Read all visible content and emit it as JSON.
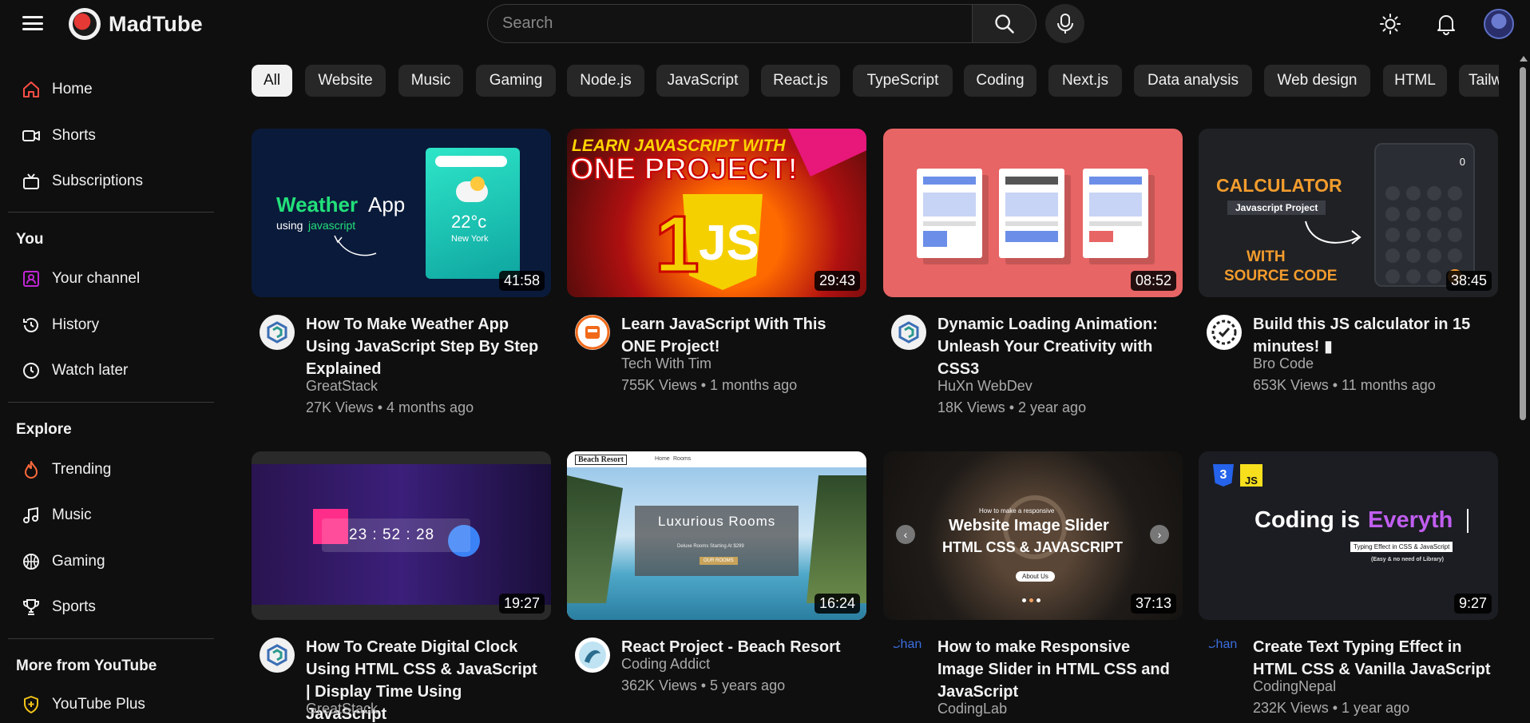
{
  "header": {
    "app_name": "MadTube",
    "search_placeholder": "Search"
  },
  "sidebar": {
    "main": [
      {
        "label": "Home",
        "icon": "home-icon"
      },
      {
        "label": "Shorts",
        "icon": "shorts-icon"
      },
      {
        "label": "Subscriptions",
        "icon": "subscriptions-icon"
      }
    ],
    "you_heading": "You",
    "you": [
      {
        "label": "Your channel",
        "icon": "your-channel-icon"
      },
      {
        "label": "History",
        "icon": "history-icon"
      },
      {
        "label": "Watch later",
        "icon": "watch-later-icon"
      }
    ],
    "explore_heading": "Explore",
    "explore": [
      {
        "label": "Trending",
        "icon": "trending-icon"
      },
      {
        "label": "Music",
        "icon": "music-icon"
      },
      {
        "label": "Gaming",
        "icon": "gaming-icon"
      },
      {
        "label": "Sports",
        "icon": "sports-icon"
      }
    ],
    "more_heading": "More from YouTube",
    "more": [
      {
        "label": "YouTube Plus",
        "icon": "youtube-plus-icon"
      }
    ]
  },
  "chips": [
    "All",
    "Website",
    "Music",
    "Gaming",
    "Node.js",
    "JavaScript",
    "React.js",
    "TypeScript",
    "Coding",
    "Next.js",
    "Data analysis",
    "Web design",
    "HTML",
    "Tailw"
  ],
  "thumb_text": {
    "weather_word": "Weather",
    "app_word": "App",
    "using": "using",
    "javascript": "javascript",
    "temp": "22°c",
    "city": "New York",
    "learn": "LEARN JAVASCRIPT WITH",
    "one_project": "ONE PROJECT!",
    "js": "JS",
    "one": "1",
    "calculator": "CALCULATOR",
    "js_project": "Javascript Project",
    "with": "WITH",
    "source_code": "SOURCE CODE",
    "calc_display": "0",
    "clock": "23 : 52 : 28",
    "beach_brand": "Beach Resort",
    "nav_home": "Home",
    "nav_rooms": "Rooms",
    "luxurious": "Luxurious Rooms",
    "deluxe": "Deluxe Rooms Starting At $299",
    "our_rooms": "OUR ROOMS",
    "slider_small": "How to make a responsive",
    "slider_title1": "Website Image Slider",
    "slider_title2": "HTML CSS & JAVASCRIPT",
    "about_us": "About Us",
    "coding_is": "Coding is",
    "everyth": "Everyth",
    "typing_label": "Typing Effect in CSS & JavaScript",
    "no_library": "(Easy & no need of Library)",
    "js_badge": "JS",
    "css_badge": "3",
    "chan_alt": "Chan"
  },
  "videos": [
    {
      "title": "How To Make Weather App Using JavaScript Step By Step Explained",
      "channel": "GreatStack",
      "stats": "27K Views • 4 months ago",
      "duration": "41:58"
    },
    {
      "title": "Learn JavaScript With This ONE Project!",
      "channel": "Tech With Tim",
      "stats": "755K Views • 1 months ago",
      "duration": "29:43"
    },
    {
      "title": "Dynamic Loading Animation: Unleash Your Creativity with CSS3",
      "channel": "HuXn WebDev",
      "stats": "18K Views • 2 year ago",
      "duration": "08:52"
    },
    {
      "title": "Build this JS calculator in 15 minutes! ▮",
      "channel": "Bro Code",
      "stats": "653K Views • 11 months ago",
      "duration": "38:45"
    },
    {
      "title": "How To Create Digital Clock Using HTML CSS & JavaScript | Display Time Using JavaScript",
      "channel": "GreatStack",
      "stats": "",
      "duration": "19:27"
    },
    {
      "title": "React Project - Beach Resort",
      "channel": "Coding Addict",
      "stats": "362K Views • 5 years ago",
      "duration": "16:24"
    },
    {
      "title": "How to make Responsive Image Slider in HTML CSS and JavaScript",
      "channel": "CodingLab",
      "stats": "",
      "duration": "37:13"
    },
    {
      "title": "Create Text Typing Effect in HTML CSS & Vanilla JavaScript",
      "channel": "CodingNepal",
      "stats": "232K Views • 1 year ago",
      "duration": "9:27"
    }
  ],
  "colors": {
    "background": "#0f0f0f",
    "chip_active": "#f1f1f1",
    "home_icon": "#ff4e45",
    "trending_icon": "#ff6a3d",
    "channel_icon": "#c026d3",
    "plus_icon": "#f5c518"
  }
}
